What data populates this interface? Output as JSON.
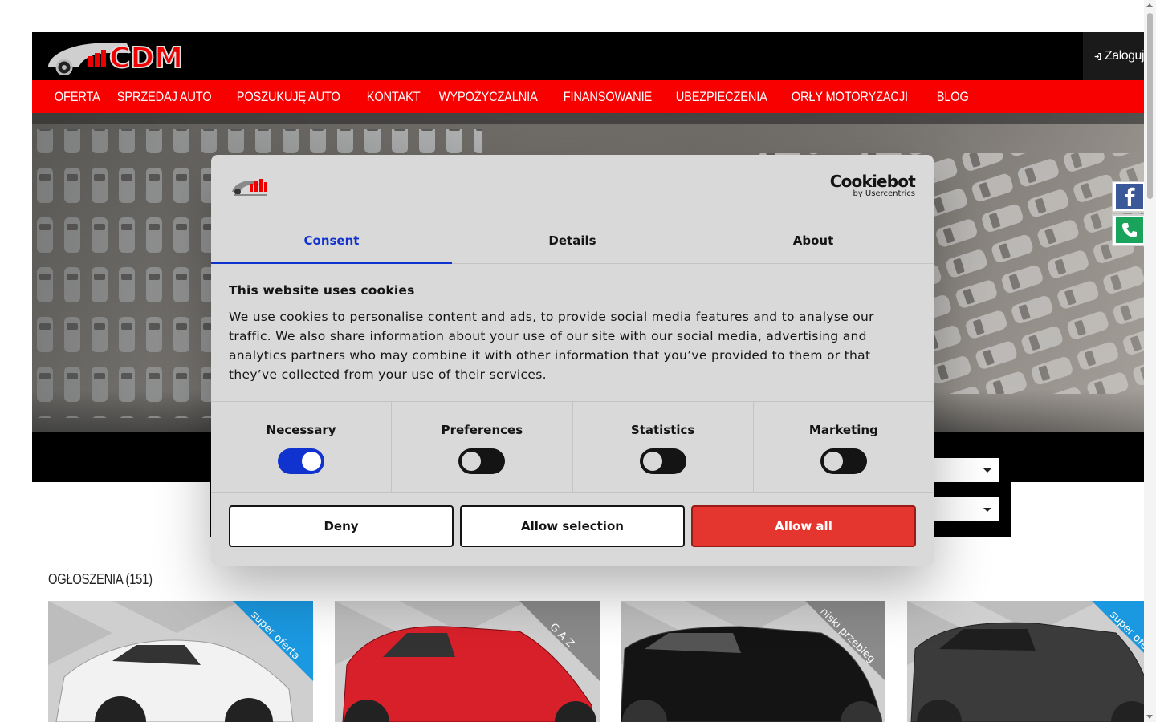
{
  "header": {
    "login_label": "Zaloguj",
    "logo_text": "CDM"
  },
  "nav": {
    "items": [
      "OFERTA",
      "SPRZEDAJ AUTO",
      "POSZUKUJĘ AUTO",
      "KONTAKT",
      "WYPOŻYCZALNIA",
      "FINANSOWANIE",
      "UBEZPIECZENIA",
      "ORŁY MOTORYZACJI",
      "BLOG"
    ]
  },
  "listings": {
    "title": "OGŁOSZENIA (151)",
    "cards": [
      {
        "badge": "super oferta",
        "badge_color": "#1a98e0",
        "car_color": "#f2f2f2"
      },
      {
        "badge": "G A Z",
        "badge_color": "#8a8a8a",
        "car_color": "#d8202a"
      },
      {
        "badge": "niski przebieg",
        "badge_color": "#8a8a8a",
        "car_color": "#141414"
      },
      {
        "badge": "super oferta",
        "badge_color": "#1a98e0",
        "car_color": "#3b3b3b"
      }
    ]
  },
  "cookie": {
    "brand": "Cookiebot",
    "brand_sub": "by Usercentrics",
    "tabs": [
      "Consent",
      "Details",
      "About"
    ],
    "heading": "This website uses cookies",
    "body": "We use cookies to personalise content and ads, to provide social media features and to analyse our traffic. We also share information about your use of our site with our social media, advertising and analytics partners who may combine it with other information that you’ve provided to them or that they’ve collected from your use of their services.",
    "categories": [
      {
        "label": "Necessary",
        "on": true
      },
      {
        "label": "Preferences",
        "on": false
      },
      {
        "label": "Statistics",
        "on": false
      },
      {
        "label": "Marketing",
        "on": false
      }
    ],
    "buttons": {
      "deny": "Deny",
      "selection": "Allow selection",
      "all": "Allow all"
    }
  },
  "colors": {
    "nav_red": "#f80000",
    "consent_blue": "#1032cf",
    "allow_all_red": "#e5352f",
    "facebook_blue": "#3b5998",
    "phone_green": "#1aa35a"
  },
  "icons": {
    "login": "sign-in-icon",
    "facebook": "facebook-icon",
    "phone": "phone-icon"
  }
}
